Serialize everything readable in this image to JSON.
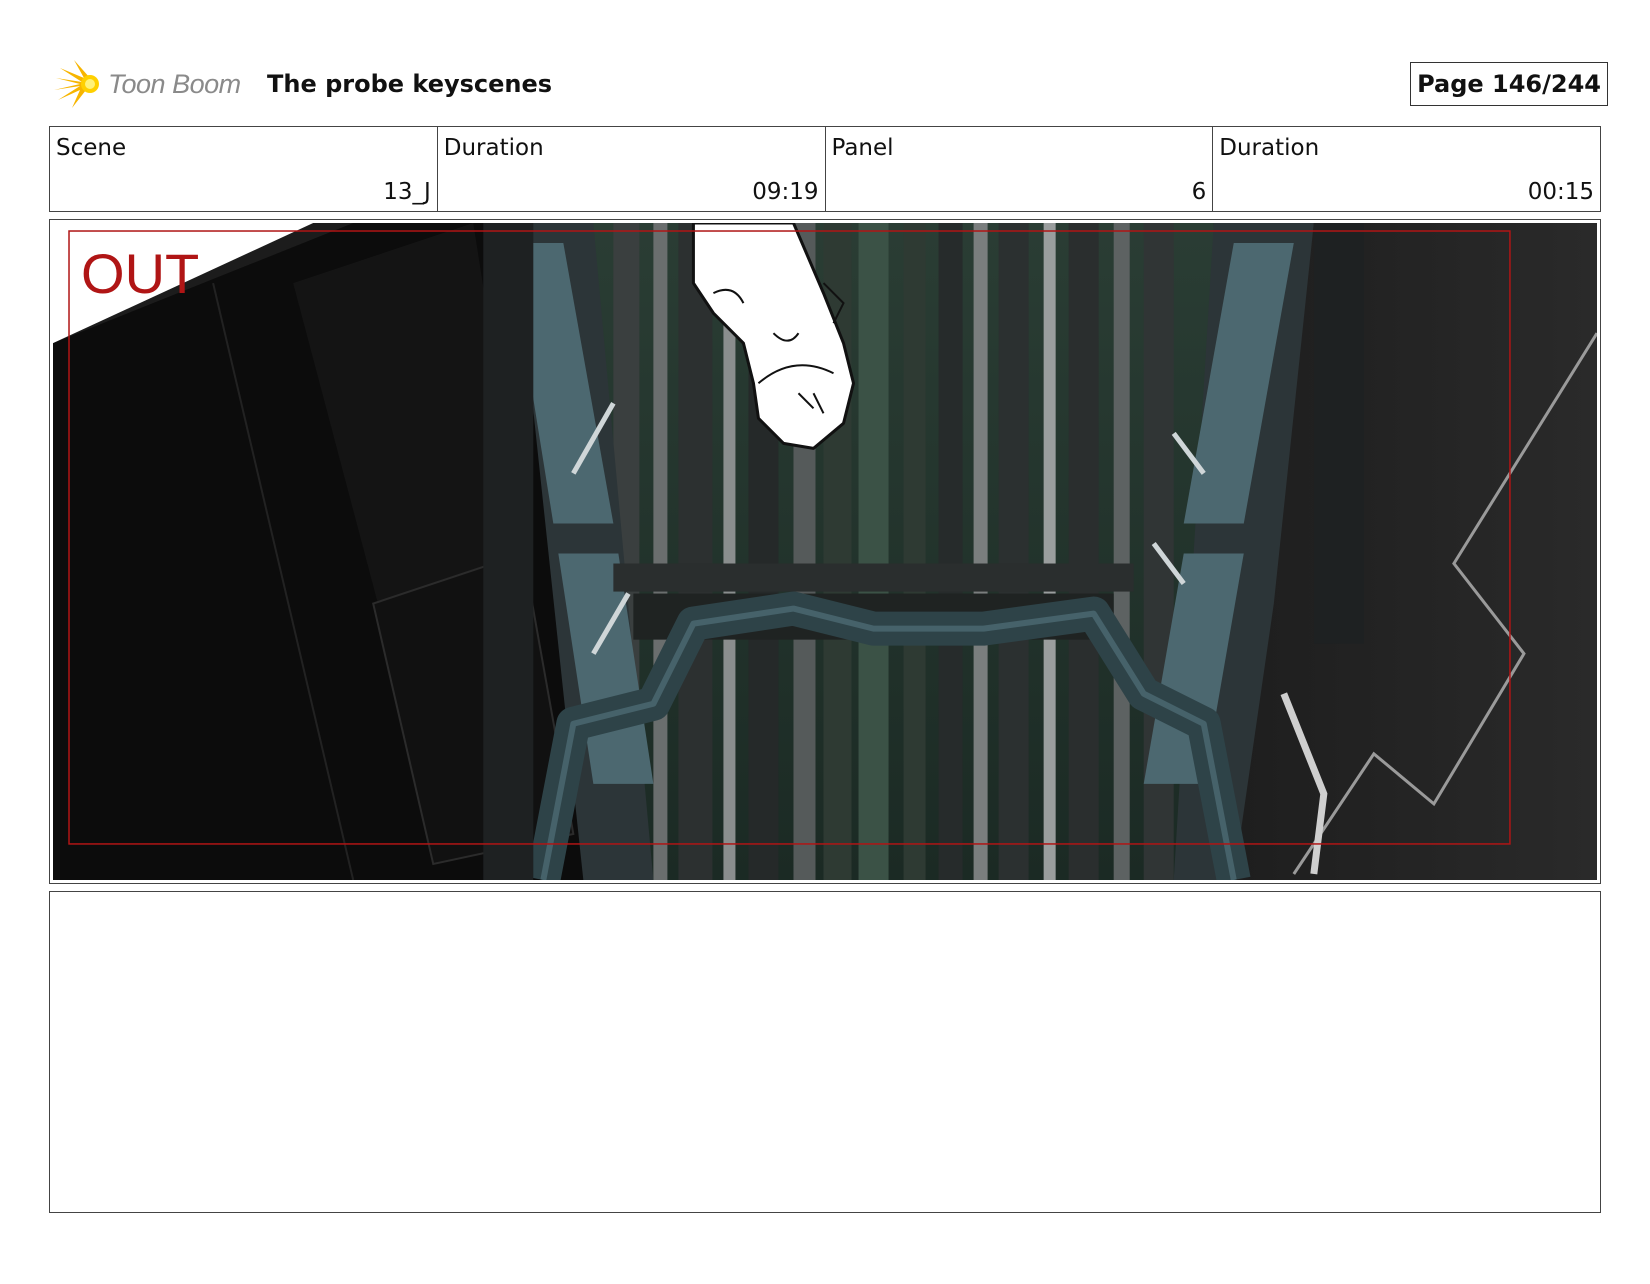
{
  "header": {
    "brand": "Toon Boom",
    "title": "The probe keyscenes",
    "page": "Page 146/244"
  },
  "info": {
    "scene_label": "Scene",
    "scene_value": "13_J",
    "scene_duration_label": "Duration",
    "scene_duration_value": "09:19",
    "panel_label": "Panel",
    "panel_value": "6",
    "panel_duration_label": "Duration",
    "panel_duration_value": "00:15"
  },
  "panel": {
    "overlay_text": "OUT",
    "overlay_color": "#b01515"
  },
  "notes": {
    "text": ""
  }
}
